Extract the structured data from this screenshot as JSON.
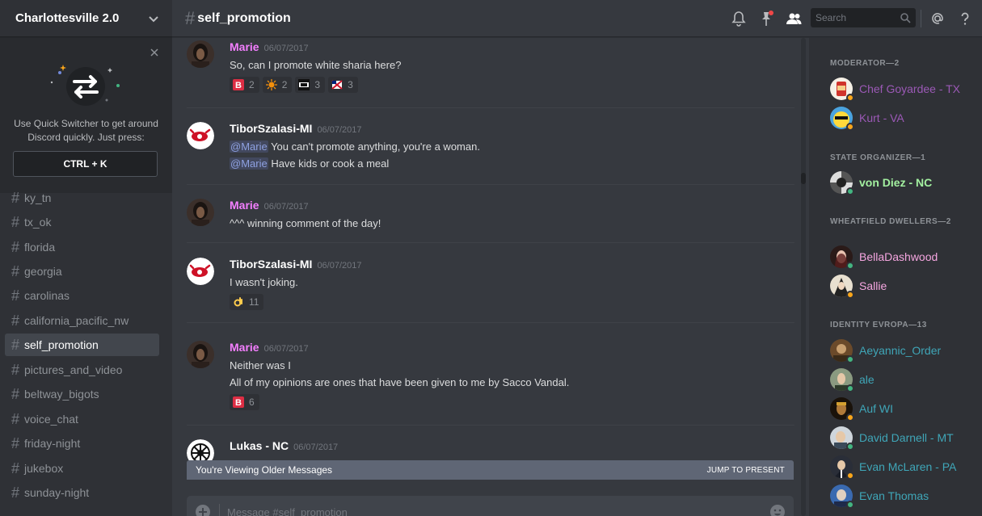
{
  "server": {
    "name": "Charlottesville 2.0"
  },
  "quick_switcher": {
    "text": "Use Quick Switcher to get around Discord quickly. Just press:",
    "shortcut": "CTRL + K"
  },
  "channels": [
    {
      "name": "ky_tn",
      "active": false
    },
    {
      "name": "tx_ok",
      "active": false
    },
    {
      "name": "florida",
      "active": false
    },
    {
      "name": "georgia",
      "active": false
    },
    {
      "name": "carolinas",
      "active": false
    },
    {
      "name": "california_pacific_nw",
      "active": false
    },
    {
      "name": "self_promotion",
      "active": true
    },
    {
      "name": "pictures_and_video",
      "active": false
    },
    {
      "name": "beltway_bigots",
      "active": false
    },
    {
      "name": "voice_chat",
      "active": false
    },
    {
      "name": "friday-night",
      "active": false
    },
    {
      "name": "jukebox",
      "active": false
    },
    {
      "name": "sunday-night",
      "active": false
    }
  ],
  "header": {
    "channel": "self_promotion",
    "search_placeholder": "Search"
  },
  "messages": [
    {
      "author": "Marie",
      "author_color": "#f47fff",
      "timestamp": "06/07/2017",
      "lines": [
        {
          "text": "So, can I promote white sharia here?"
        }
      ],
      "reactions": [
        {
          "emoji": "b-red-icon",
          "count": "2"
        },
        {
          "emoji": "sun-icon",
          "count": "2"
        },
        {
          "emoji": "fail-icon",
          "count": "3"
        },
        {
          "emoji": "flag-icon",
          "count": "3"
        }
      ]
    },
    {
      "author": "TiborSzalasi-MI",
      "author_color": "#ffffff",
      "timestamp": "06/07/2017",
      "lines": [
        {
          "mention": "@Marie",
          "text": " You can't promote anything, you're a woman."
        },
        {
          "mention": "@Marie",
          "text": " Have kids or cook a meal"
        }
      ],
      "reactions": []
    },
    {
      "author": "Marie",
      "author_color": "#f47fff",
      "timestamp": "06/07/2017",
      "lines": [
        {
          "text": "^^^ winning comment of the day!"
        }
      ],
      "reactions": []
    },
    {
      "author": "TiborSzalasi-MI",
      "author_color": "#ffffff",
      "timestamp": "06/07/2017",
      "lines": [
        {
          "text": "I wasn't joking."
        }
      ],
      "reactions": [
        {
          "emoji": "ok-hand-icon",
          "count": "11"
        }
      ]
    },
    {
      "author": "Marie",
      "author_color": "#f47fff",
      "timestamp": "06/07/2017",
      "lines": [
        {
          "text": "Neither was I"
        },
        {
          "text": "All of my opinions are ones that have been given to me by Sacco Vandal."
        }
      ],
      "reactions": [
        {
          "emoji": "b-red-icon",
          "count": "6"
        }
      ]
    },
    {
      "author": "Lukas - NC",
      "author_color": "#ffffff",
      "timestamp": "06/07/2017",
      "lines": [],
      "reactions": []
    }
  ],
  "older_banner": {
    "text": "You're Viewing Older Messages",
    "jump": "JUMP TO PRESENT"
  },
  "composer": {
    "placeholder": "Message #self_promotion"
  },
  "member_groups": [
    {
      "title": "MODERATOR—2",
      "members": [
        {
          "name": "Chef Goyardee - TX",
          "color": "#9b59b6",
          "status": "idle"
        },
        {
          "name": "Kurt - VA",
          "color": "#9b59b6",
          "status": "idle"
        }
      ]
    },
    {
      "title": "STATE ORGANIZER—1",
      "members": [
        {
          "name": "von Diez - NC",
          "color": "#a3f0a0",
          "status": "online"
        }
      ]
    },
    {
      "title": "WHEATFIELD DWELLERS—2",
      "members": [
        {
          "name": "BellaDashwood",
          "color": "#f5a6e0",
          "status": "online"
        },
        {
          "name": "Sallie",
          "color": "#f5a6e0",
          "status": "idle"
        }
      ]
    },
    {
      "title": "IDENTITY EVROPA—13",
      "members": [
        {
          "name": "Aeyannic_Order",
          "color": "#3fa6b8",
          "status": "online"
        },
        {
          "name": "ale",
          "color": "#3fa6b8",
          "status": "online"
        },
        {
          "name": "Auf WI",
          "color": "#3fa6b8",
          "status": "idle"
        },
        {
          "name": "David Darnell - MT",
          "color": "#3fa6b8",
          "status": "online"
        },
        {
          "name": "Evan McLaren - PA",
          "color": "#3fa6b8",
          "status": "idle"
        },
        {
          "name": "Evan Thomas",
          "color": "#3fa6b8",
          "status": "online"
        }
      ]
    }
  ],
  "colors": {
    "online": "#43b581",
    "idle": "#faa61a",
    "accent": "#7289da"
  }
}
